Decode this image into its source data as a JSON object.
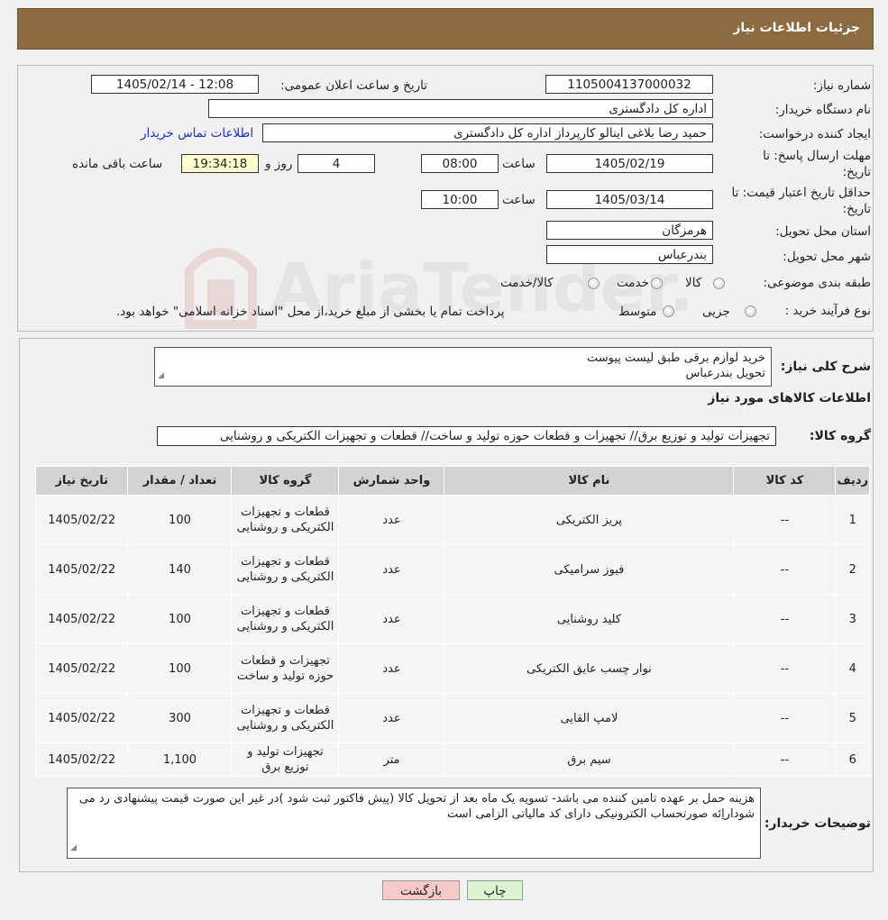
{
  "header": {
    "title": "جزئیات اطلاعات نیاز"
  },
  "form": {
    "need_number_label": "شماره نیاز:",
    "need_number": "1105004137000032",
    "announce_label": "تاریخ و ساعت اعلان عمومی:",
    "announce_value": "1405/02/14 - 12:08",
    "buyer_label": "نام دستگاه خریدار:",
    "buyer_value": "اداره کل دادگستری",
    "creator_label": "ایجاد کننده درخواست:",
    "creator_value": "حمید رضا  بلاغی اینالو کارپرداز اداره کل دادگستری",
    "contact_link": "اطلاعات تماس خریدار",
    "deadline_label_1": "مهلت ارسال پاسخ: تا",
    "deadline_label_2": "تاریخ:",
    "deadline_date": "1405/02/19",
    "time_label": "ساعت",
    "deadline_time": "08:00",
    "days_value": "4",
    "days_label": "روز و",
    "remaining_time": "19:34:18",
    "remaining_label": "ساعت باقی مانده",
    "validity_label_1": "حداقل تاریخ اعتبار قیمت: تا",
    "validity_label_2": "تاریخ:",
    "validity_date": "1405/03/14",
    "validity_time_label": "ساعت",
    "validity_time": "10:00",
    "province_label": "استان محل تحویل:",
    "province_value": "هرمزگان",
    "city_label": "شهر محل تحویل:",
    "city_value": "بندرعباس",
    "category_label": "طبقه بندی موضوعی:",
    "category_options": [
      "کالا",
      "خدمت",
      "کالا/خدمت"
    ],
    "process_label": "نوع فرآیند خرید :",
    "process_options": [
      "جزیی",
      "متوسط"
    ],
    "process_note": "پرداخت تمام یا بخشی از مبلغ خرید،از محل \"اسناد خزانه اسلامی\" خواهد بود."
  },
  "summary": {
    "label": "شرح کلی نیاز:",
    "line1": "خرید لوازم برقی طبق لیست پیوست",
    "line2": "تحویل بندرعباس"
  },
  "goods": {
    "section_title": "اطلاعات کالاهای مورد نیاز",
    "group_label": "گروه کالا:",
    "group_value": "تجهیزات تولید و توزیع برق// تجهیزات و قطعات حوزه تولید و ساخت// قطعات و تجهیزات الکتریکی و روشنایی"
  },
  "table": {
    "headers": [
      "ردیف",
      "کد کالا",
      "نام کالا",
      "واحد شمارش",
      "گروه کالا",
      "تعداد / مقدار",
      "تاریخ نیاز"
    ],
    "rows": [
      [
        "1",
        "--",
        "پریز الکتریکی",
        "عدد",
        "قطعات و تجهیزات الکتریکی و روشنایی",
        "100",
        "1405/02/22"
      ],
      [
        "2",
        "--",
        "فیوز سرامیکی",
        "عدد",
        "قطعات و تجهیزات الکتریکی و روشنایی",
        "140",
        "1405/02/22"
      ],
      [
        "3",
        "--",
        "کلید روشنایی",
        "عدد",
        "قطعات و تجهیزات الکتریکی و روشنایی",
        "100",
        "1405/02/22"
      ],
      [
        "4",
        "--",
        "نوار چسب عایق الکتریکی",
        "عدد",
        "تجهیزات و قطعات حوزه تولید و ساخت",
        "100",
        "1405/02/22"
      ],
      [
        "5",
        "--",
        "لامپ القایی",
        "عدد",
        "قطعات و تجهیزات الکتریکی و روشنایی",
        "300",
        "1405/02/22"
      ],
      [
        "6",
        "--",
        "سیم برق",
        "متر",
        "تجهیزات تولید و توزیع برق",
        "1,100",
        "1405/02/22"
      ]
    ]
  },
  "buyer_notes": {
    "label": "توضیحات خریدار:",
    "text": "هزینه حمل بر عهده تامین کننده می باشد- تسویه یک ماه بعد از تحویل کالا (پیش فاکتور ثبت شود )در غیر این صورت قیمت پیشنهادی رد می شوداراِئه صورتحساب الکترونیکی دارای کد مالیاتی الزامی است"
  },
  "buttons": {
    "print": "چاپ",
    "back": "بازگشت"
  },
  "watermark": {
    "text": "AriaTender.neT"
  },
  "colors": {
    "header": "#8c6b40",
    "link": "#1a33b5",
    "back_button": "#f7c9c9",
    "print_button": "#dcf5d0"
  }
}
